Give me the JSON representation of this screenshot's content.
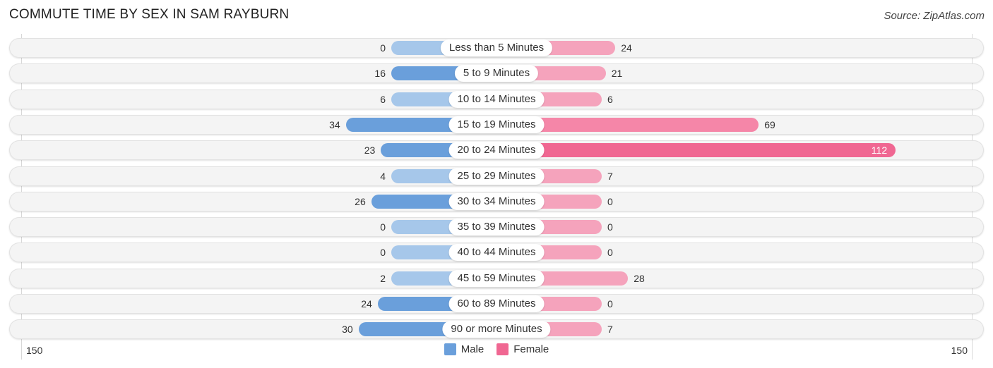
{
  "header": {
    "title": "COMMUTE TIME BY SEX IN SAM RAYBURN",
    "source": "Source: ZipAtlas.com"
  },
  "colors": {
    "male_strong": "#6a9fdb",
    "male_light": "#a6c7ea",
    "female_strong": "#f06792",
    "female_light": "#f5a3bc"
  },
  "chart_data": {
    "type": "bar",
    "orientation": "horizontal-diverging",
    "title": "COMMUTE TIME BY SEX IN SAM RAYBURN",
    "categories": [
      "Less than 5 Minutes",
      "5 to 9 Minutes",
      "10 to 14 Minutes",
      "15 to 19 Minutes",
      "20 to 24 Minutes",
      "25 to 29 Minutes",
      "30 to 34 Minutes",
      "35 to 39 Minutes",
      "40 to 44 Minutes",
      "45 to 59 Minutes",
      "60 to 89 Minutes",
      "90 or more Minutes"
    ],
    "series": [
      {
        "name": "Male",
        "values": [
          0,
          16,
          6,
          34,
          23,
          4,
          26,
          0,
          0,
          2,
          24,
          30
        ]
      },
      {
        "name": "Female",
        "values": [
          24,
          21,
          6,
          69,
          112,
          7,
          0,
          0,
          0,
          28,
          0,
          7
        ]
      }
    ],
    "axis": {
      "left_tick": "150",
      "right_tick": "150",
      "range": [
        -150,
        150
      ]
    },
    "legend": {
      "position": "bottom-center",
      "entries": [
        "Male",
        "Female"
      ]
    },
    "grid": false
  }
}
